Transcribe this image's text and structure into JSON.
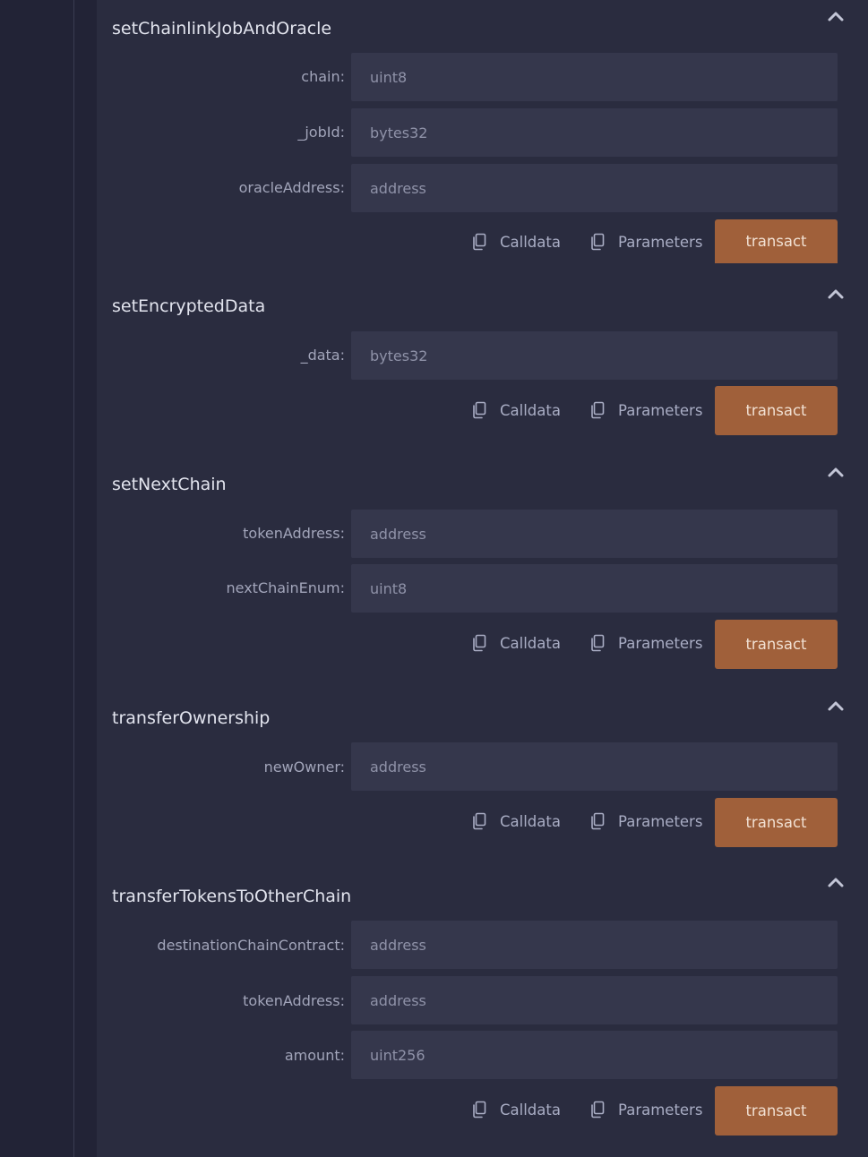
{
  "functions": [
    {
      "name": "setChainlinkJobAndOracle",
      "params": [
        {
          "label": "chain:",
          "placeholder": "uint8"
        },
        {
          "label": "_jobId:",
          "placeholder": "bytes32"
        },
        {
          "label": "oracleAddress:",
          "placeholder": "address"
        }
      ],
      "calldata_label": "Calldata",
      "parameters_label": "Parameters",
      "transact_label": "transact"
    },
    {
      "name": "setEncryptedData",
      "params": [
        {
          "label": "_data:",
          "placeholder": "bytes32"
        }
      ],
      "calldata_label": "Calldata",
      "parameters_label": "Parameters",
      "transact_label": "transact"
    },
    {
      "name": "setNextChain",
      "params": [
        {
          "label": "tokenAddress:",
          "placeholder": "address"
        },
        {
          "label": "nextChainEnum:",
          "placeholder": "uint8"
        }
      ],
      "calldata_label": "Calldata",
      "parameters_label": "Parameters",
      "transact_label": "transact"
    },
    {
      "name": "transferOwnership",
      "params": [
        {
          "label": "newOwner:",
          "placeholder": "address"
        }
      ],
      "calldata_label": "Calldata",
      "parameters_label": "Parameters",
      "transact_label": "transact"
    },
    {
      "name": "transferTokensToOtherChain",
      "params": [
        {
          "label": "destinationChainContract:",
          "placeholder": "address"
        },
        {
          "label": "tokenAddress:",
          "placeholder": "address"
        },
        {
          "label": "amount:",
          "placeholder": "uint256"
        }
      ],
      "calldata_label": "Calldata",
      "parameters_label": "Parameters",
      "transact_label": "transact"
    }
  ],
  "icons": {
    "collapse": "chevron-up-icon",
    "copy": "copy-icon"
  },
  "colors": {
    "background": "#222336",
    "panel": "#2a2c3f",
    "input": "#35374c",
    "transact_button": "#a0603a",
    "link_text": "#a9adc4"
  }
}
